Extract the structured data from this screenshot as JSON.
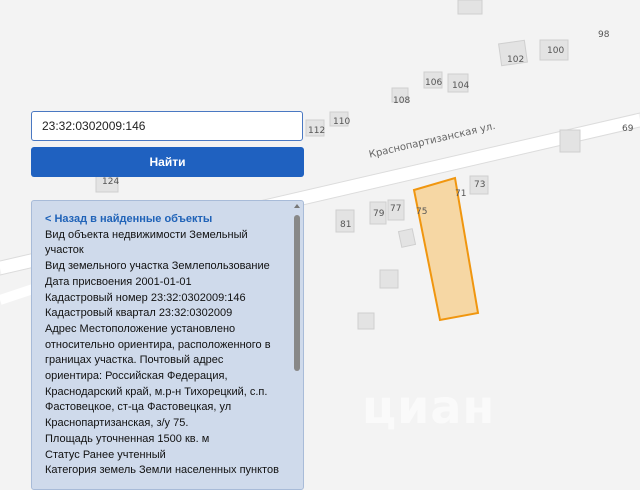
{
  "search": {
    "value": "23:32:0302009:146"
  },
  "find_button": {
    "label": "Найти"
  },
  "map": {
    "street": "Краснопартизанская ул.",
    "watermark": "циан",
    "house_numbers": [
      "98",
      "100",
      "102",
      "106",
      "104",
      "108",
      "110",
      "112",
      "69",
      "124",
      "73",
      "71",
      "81",
      "79",
      "77",
      "75"
    ]
  },
  "info": {
    "back": "< Назад в найденные объекты",
    "lines": [
      "Вид объекта недвижимости Земельный",
      "участок",
      "Вид земельного участка Землепользование",
      "Дата присвоения 2001-01-01",
      "Кадастровый номер 23:32:0302009:146",
      "Кадастровый квартал 23:32:0302009",
      "Адрес Местоположение установлено",
      "относительно ориентира, расположенного в",
      "границах участка. Почтовый адрес",
      "ориентира: Российская Федерация,",
      "Краснодарский край, м.р-н Тихорецкий, с.п.",
      "Фастовецкое, ст-ца Фастовецкая, ул",
      "Краснопартизанская, з/у 75.",
      "Площадь уточненная 1500 кв. м",
      "Статус Ранее учтенный",
      "Категория земель Земли населенных пунктов"
    ]
  },
  "colors": {
    "parcel_fill": "#f7cd8a",
    "parcel_stroke": "#f0960f",
    "button": "#1f61c0",
    "panel": "#cfdaeb"
  }
}
